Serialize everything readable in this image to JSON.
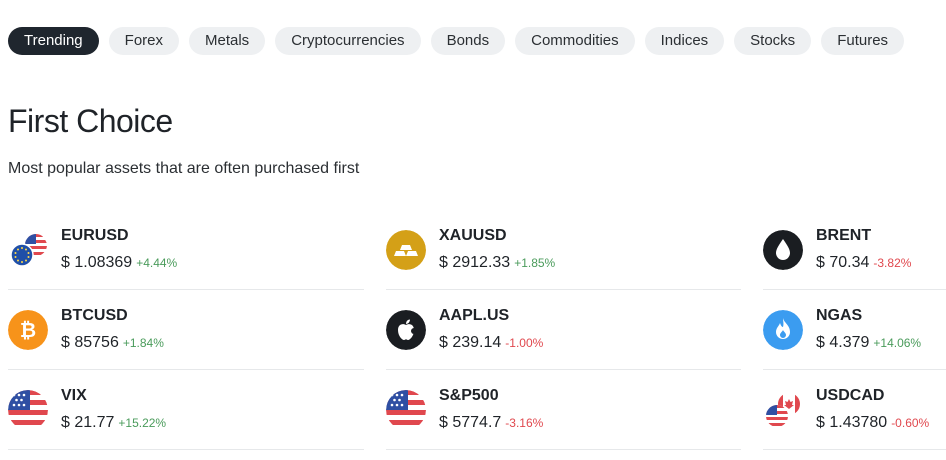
{
  "tabs": [
    {
      "label": "Trending",
      "active": true
    },
    {
      "label": "Forex"
    },
    {
      "label": "Metals"
    },
    {
      "label": "Cryptocurrencies"
    },
    {
      "label": "Bonds"
    },
    {
      "label": "Commodities"
    },
    {
      "label": "Indices"
    },
    {
      "label": "Stocks"
    },
    {
      "label": "Futures"
    }
  ],
  "section": {
    "title": "First Choice",
    "subtitle": "Most popular assets that are often purchased first"
  },
  "assets": [
    {
      "symbol": "EURUSD",
      "price": "$ 1.08369",
      "change": "+4.44%",
      "direction": "up",
      "icon": "eu-us-flags-icon"
    },
    {
      "symbol": "XAUUSD",
      "price": "$ 2912.33",
      "change": "+1.85%",
      "direction": "up",
      "icon": "gold-bars-icon"
    },
    {
      "symbol": "BRENT",
      "price": "$ 70.34",
      "change": "-3.82%",
      "direction": "down",
      "icon": "oil-drop-icon"
    },
    {
      "symbol": "BTCUSD",
      "price": "$ 85756",
      "change": "+1.84%",
      "direction": "up",
      "icon": "bitcoin-icon"
    },
    {
      "symbol": "AAPL.US",
      "price": "$ 239.14",
      "change": "-1.00%",
      "direction": "down",
      "icon": "apple-icon"
    },
    {
      "symbol": "NGAS",
      "price": "$ 4.379",
      "change": "+14.06%",
      "direction": "up",
      "icon": "flame-icon"
    },
    {
      "symbol": "VIX",
      "price": "$ 21.77",
      "change": "+15.22%",
      "direction": "up",
      "icon": "us-flag-icon"
    },
    {
      "symbol": "S&P500",
      "price": "$ 5774.7",
      "change": "-3.16%",
      "direction": "down",
      "icon": "us-flag-icon"
    },
    {
      "symbol": "USDCAD",
      "price": "$ 1.43780",
      "change": "-0.60%",
      "direction": "down",
      "icon": "us-ca-flags-icon"
    }
  ],
  "colors": {
    "active_tab": "#1f262e",
    "tab_bg": "#eef0f2",
    "up": "#4a9b5b",
    "down": "#e0484e",
    "gold": "#d4a017",
    "bitcoin": "#f7931a",
    "gas": "#3b9cf0"
  }
}
